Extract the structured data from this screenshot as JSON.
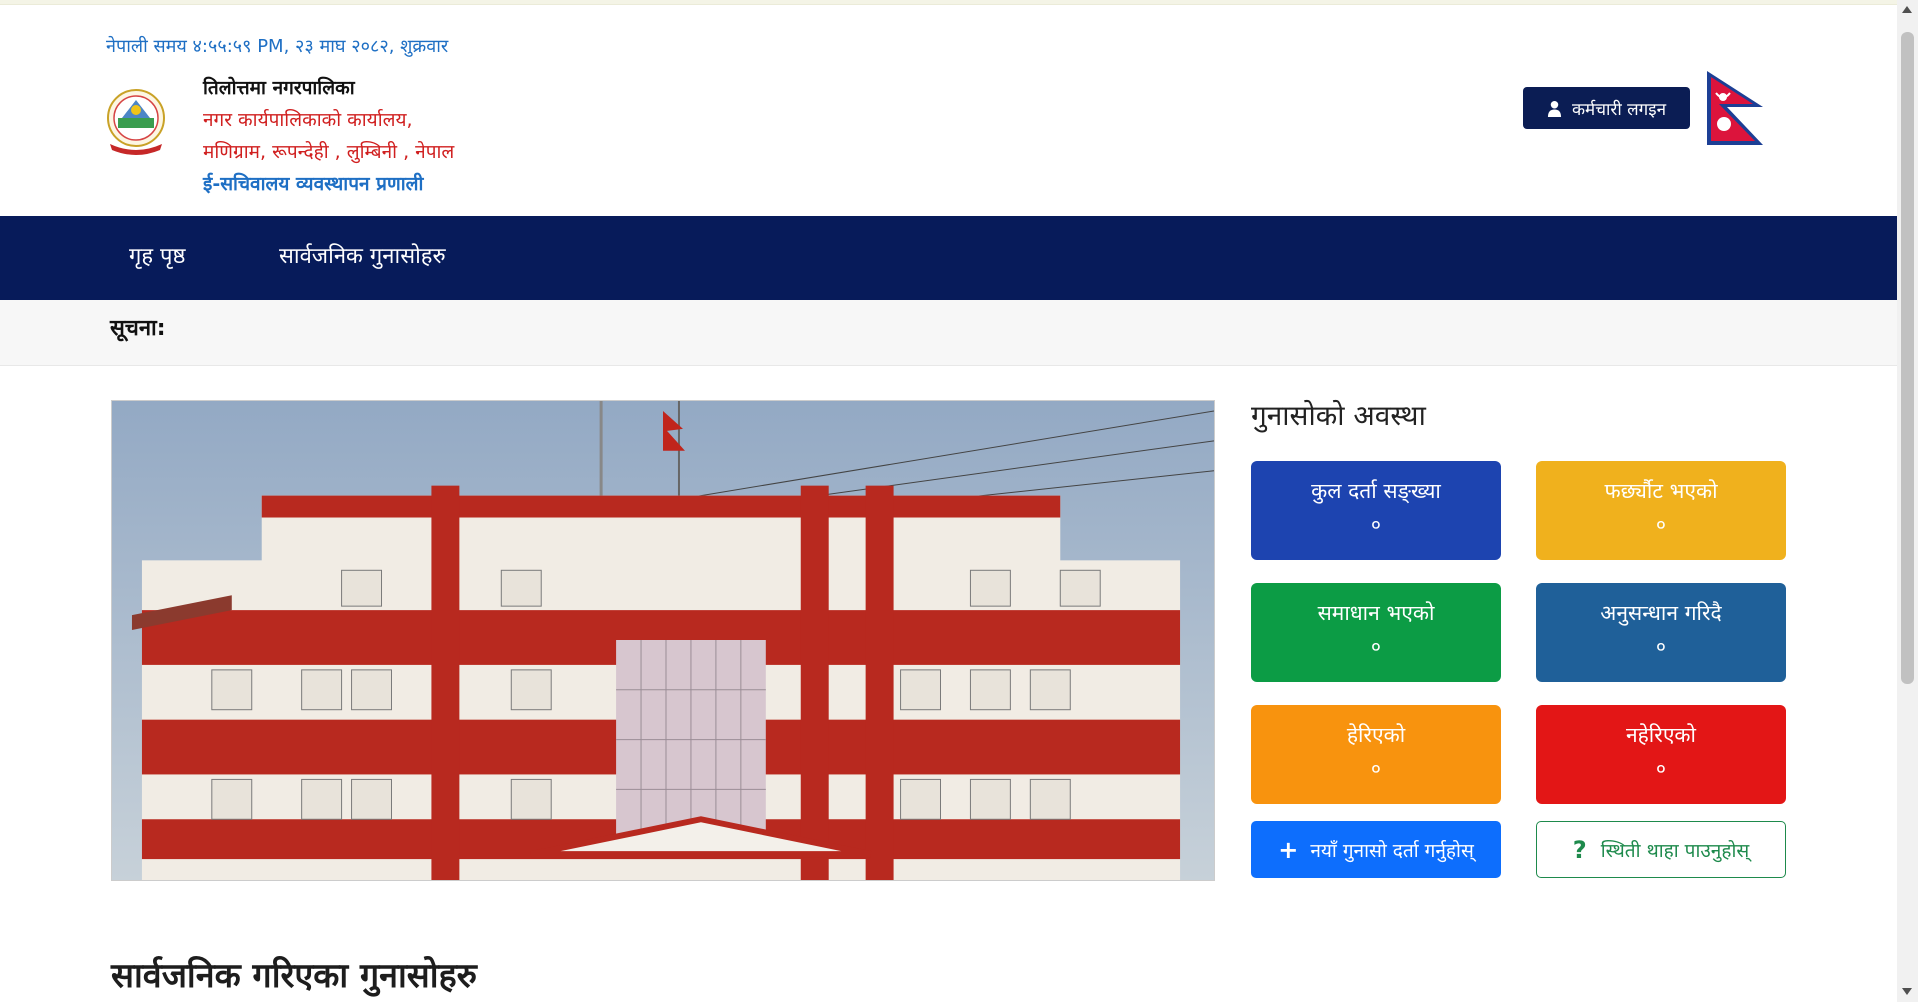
{
  "header": {
    "datetime": "नेपाली समय ४:५५:५९ PM, २३ माघ २०८२, शुक्रवार",
    "org_name": "तिलोत्तमा नगरपालिका",
    "office": "नगर कार्यपालिकाको कार्यालय,",
    "address": "मणिग्राम, रूपन्देही , लुम्बिनी , नेपाल",
    "system_name": "ई-सचिवालय व्यवस्थापन प्रणाली",
    "login_label": "कर्मचारी लगइन",
    "login_icon": "user-icon"
  },
  "nav": {
    "items": [
      {
        "label": "गृह पृष्ठ"
      },
      {
        "label": "सार्वजनिक गुनासोहरु"
      }
    ]
  },
  "notice": {
    "label": "सूचना:"
  },
  "status": {
    "title": "गुनासोको अवस्था",
    "cards": [
      {
        "label": "कुल दर्ता सङ्ख्या",
        "value": "०",
        "color": "#1d44b0"
      },
      {
        "label": "फर्छ्यौट भएको",
        "value": "०",
        "color": "#f0b11d"
      },
      {
        "label": "समाधान भएको",
        "value": "०",
        "color": "#0c9c45"
      },
      {
        "label": "अनुसन्धान गरिदै",
        "value": "०",
        "color": "#1f6099"
      },
      {
        "label": "हेरिएको",
        "value": "०",
        "color": "#f8930e"
      },
      {
        "label": "नहेरिएको",
        "value": "०",
        "color": "#e31616"
      }
    ],
    "new_complaint_label": "नयाँ गुनासो दर्ता गर्नुहोस्",
    "new_complaint_icon": "plus-icon",
    "check_status_label": "स्थिती थाहा पाउनुहोस्",
    "check_status_icon": "question-icon"
  },
  "public_section": {
    "title": "सार्वजनिक गरिएका गुनासोहरु"
  },
  "colors": {
    "navbar": "#071b5a",
    "login_button": "#0b1d54",
    "primary_link": "#1e6fc4",
    "accent_red": "#d01f1f"
  }
}
